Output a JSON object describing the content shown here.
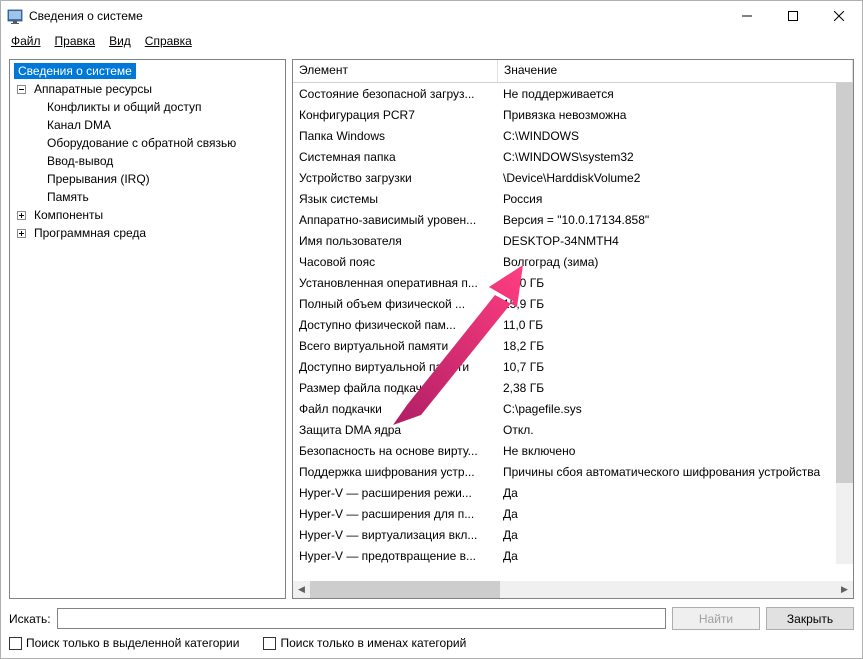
{
  "titlebar": {
    "title": "Сведения о системе"
  },
  "menu": {
    "file": "Файл",
    "edit": "Правка",
    "view": "Вид",
    "help": "Справка"
  },
  "tree": {
    "root": "Сведения о системе",
    "hardware": "Аппаратные ресурсы",
    "hw_children": [
      "Конфликты и общий доступ",
      "Канал DMA",
      "Оборудование с обратной связью",
      "Ввод-вывод",
      "Прерывания (IRQ)",
      "Память"
    ],
    "components": "Компоненты",
    "software": "Программная среда"
  },
  "columns": {
    "element": "Элемент",
    "value": "Значение"
  },
  "rows": [
    {
      "el": "Состояние безопасной загруз...",
      "val": "Не поддерживается"
    },
    {
      "el": "Конфигурация PCR7",
      "val": "Привязка невозможна"
    },
    {
      "el": "Папка Windows",
      "val": "C:\\WINDOWS"
    },
    {
      "el": "Системная папка",
      "val": "C:\\WINDOWS\\system32"
    },
    {
      "el": "Устройство загрузки",
      "val": "\\Device\\HarddiskVolume2"
    },
    {
      "el": "Язык системы",
      "val": "Россия"
    },
    {
      "el": "Аппаратно-зависимый уровен...",
      "val": "Версия = \"10.0.17134.858\""
    },
    {
      "el": "Имя пользователя",
      "val": "DESKTOP-34NMTH4"
    },
    {
      "el": "Часовой пояс",
      "val": "Волгоград (зима)"
    },
    {
      "el": "Установленная оперативная п...",
      "val": "16,0 ГБ"
    },
    {
      "el": "Полный объем физической ...",
      "val": "15,9 ГБ"
    },
    {
      "el": "Доступно физической пам...",
      "val": "11,0 ГБ"
    },
    {
      "el": "Всего виртуальной памяти",
      "val": "18,2 ГБ"
    },
    {
      "el": "Доступно виртуальной памяти",
      "val": "10,7 ГБ"
    },
    {
      "el": "Размер файла подкачки",
      "val": "2,38 ГБ"
    },
    {
      "el": "Файл подкачки",
      "val": "C:\\pagefile.sys"
    },
    {
      "el": "Защита DMA ядра",
      "val": "Откл."
    },
    {
      "el": "Безопасность на основе вирту...",
      "val": "Не включено"
    },
    {
      "el": "Поддержка шифрования устр...",
      "val": "Причины сбоя автоматического шифрования устройства"
    },
    {
      "el": "Hyper-V — расширения режи...",
      "val": "Да"
    },
    {
      "el": "Hyper-V — расширения для п...",
      "val": "Да"
    },
    {
      "el": "Hyper-V — виртуализация вкл...",
      "val": "Да"
    },
    {
      "el": "Hyper-V — предотвращение в...",
      "val": "Да"
    }
  ],
  "search": {
    "label": "Искать:",
    "find_btn": "Найти",
    "close_btn": "Закрыть",
    "chk_selected": "Поиск только в выделенной категории",
    "chk_names": "Поиск только в именах категорий"
  }
}
